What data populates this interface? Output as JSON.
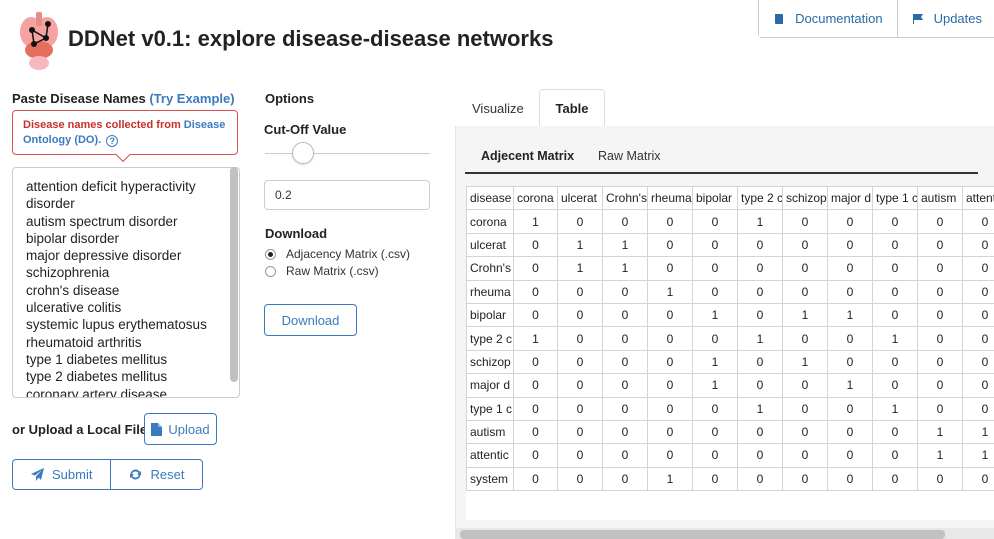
{
  "header": {
    "title": "DDNet v0.1: explore disease-disease networks",
    "buttons": [
      {
        "label": "Documentation",
        "icon": "book-icon"
      },
      {
        "label": "Updates",
        "icon": "flag-icon"
      }
    ]
  },
  "input_panel": {
    "label": "Paste Disease Names",
    "try_example": "(Try Example)",
    "tooltip_text": "Disease names collected from ",
    "tooltip_link": "Disease Ontology (DO).",
    "tooltip_help": "?",
    "textarea_value": "attention deficit hyperactivity\ndisorder\nautism spectrum disorder\nbipolar disorder\nmajor depressive disorder\nschizophrenia\ncrohn's disease\nulcerative colitis\nsystemic lupus erythematosus\nrheumatoid arthritis\ntype 1 diabetes mellitus\ntype 2 diabetes mellitus\ncoronary artery disease",
    "upload_label": "or Upload a Local File:",
    "upload_button": "Upload",
    "submit_button": "Submit",
    "reset_button": "Reset"
  },
  "options": {
    "title": "Options",
    "cutoff_label": "Cut-Off Value",
    "cutoff_value": "0.2",
    "download_title": "Download",
    "radio_options": [
      {
        "label": "Adjacency Matrix (.csv)",
        "checked": true
      },
      {
        "label": "Raw Matrix (.csv)",
        "checked": false
      }
    ],
    "download_button": "Download"
  },
  "tabs": [
    {
      "label": "Visualize",
      "active": false
    },
    {
      "label": "Table",
      "active": true
    }
  ],
  "sub_tabs": [
    {
      "label": "Adjecent Matrix",
      "active": true
    },
    {
      "label": "Raw Matrix",
      "active": false
    }
  ],
  "matrix": {
    "columns": [
      "disease",
      "corona",
      "ulcerat",
      "Crohn's",
      "rheuma",
      "bipolar",
      "type 2 c",
      "schizop",
      "major d",
      "type 1 c",
      "autism",
      "attenti"
    ],
    "rows": [
      {
        "name": "corona",
        "values": [
          "1",
          "0",
          "0",
          "0",
          "0",
          "1",
          "0",
          "0",
          "0",
          "0",
          "0"
        ]
      },
      {
        "name": "ulcerat",
        "values": [
          "0",
          "1",
          "1",
          "0",
          "0",
          "0",
          "0",
          "0",
          "0",
          "0",
          "0"
        ]
      },
      {
        "name": "Crohn's",
        "values": [
          "0",
          "1",
          "1",
          "0",
          "0",
          "0",
          "0",
          "0",
          "0",
          "0",
          "0"
        ]
      },
      {
        "name": "rheuma",
        "values": [
          "0",
          "0",
          "0",
          "1",
          "0",
          "0",
          "0",
          "0",
          "0",
          "0",
          "0"
        ]
      },
      {
        "name": "bipolar",
        "values": [
          "0",
          "0",
          "0",
          "0",
          "1",
          "0",
          "1",
          "1",
          "0",
          "0",
          "0"
        ]
      },
      {
        "name": "type 2 c",
        "values": [
          "1",
          "0",
          "0",
          "0",
          "0",
          "1",
          "0",
          "0",
          "1",
          "0",
          "0"
        ]
      },
      {
        "name": "schizop",
        "values": [
          "0",
          "0",
          "0",
          "0",
          "1",
          "0",
          "1",
          "0",
          "0",
          "0",
          "0"
        ]
      },
      {
        "name": "major d",
        "values": [
          "0",
          "0",
          "0",
          "0",
          "1",
          "0",
          "0",
          "1",
          "0",
          "0",
          "0"
        ]
      },
      {
        "name": "type 1 c",
        "values": [
          "0",
          "0",
          "0",
          "0",
          "0",
          "1",
          "0",
          "0",
          "1",
          "0",
          "0"
        ]
      },
      {
        "name": "autism",
        "values": [
          "0",
          "0",
          "0",
          "0",
          "0",
          "0",
          "0",
          "0",
          "0",
          "1",
          "1"
        ]
      },
      {
        "name": "attentic",
        "values": [
          "0",
          "0",
          "0",
          "0",
          "0",
          "0",
          "0",
          "0",
          "0",
          "1",
          "1"
        ]
      },
      {
        "name": "system",
        "values": [
          "0",
          "0",
          "0",
          "1",
          "0",
          "0",
          "0",
          "0",
          "0",
          "0",
          "0"
        ]
      }
    ]
  },
  "colors": {
    "accent": "#3a7bbf",
    "error": "#d9534f"
  }
}
